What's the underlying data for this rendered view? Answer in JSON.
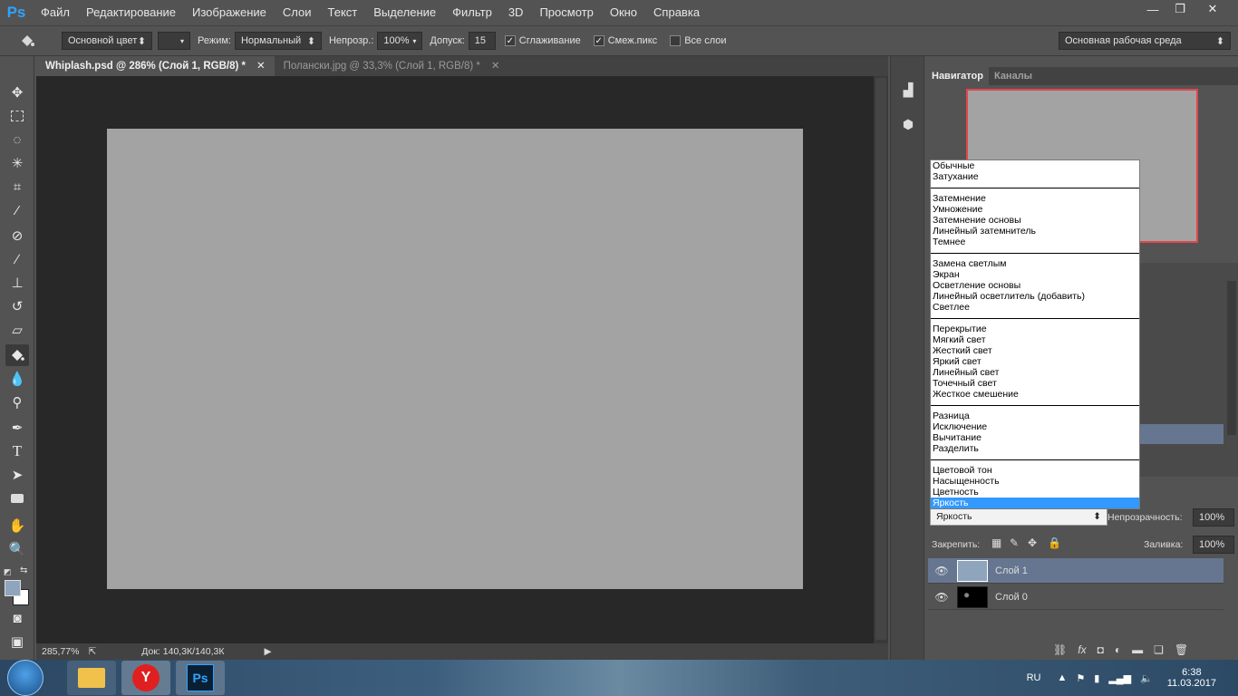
{
  "app": {
    "logo": "Ps",
    "menu": [
      "Файл",
      "Редактирование",
      "Изображение",
      "Слои",
      "Текст",
      "Выделение",
      "Фильтр",
      "3D",
      "Просмотр",
      "Окно",
      "Справка"
    ],
    "window_buttons": [
      "—",
      "❐",
      "✕"
    ]
  },
  "options": {
    "source": "Основной цвет",
    "mode_label": "Режим:",
    "mode_value": "Нормальный",
    "opacity_label": "Непрозр.:",
    "opacity_value": "100%",
    "tolerance_label": "Допуск:",
    "tolerance_value": "15",
    "antialias_label": "Сглаживание",
    "contiguous_label": "Смеж.пикс",
    "all_layers_label": "Все слои",
    "workspace": "Основная рабочая среда"
  },
  "tabs": [
    {
      "label": "Whiplash.psd @ 286% (Слой 1, RGB/8) *",
      "close": "✕"
    },
    {
      "label": "Полански.jpg @ 33,3% (Слой 1, RGB/8) *",
      "close": "✕"
    }
  ],
  "status": {
    "zoom": "285,77%",
    "doc": "Док: 140,3К/140,3К"
  },
  "navigator": {
    "tab_navigator": "Навигатор",
    "tab_channels": "Каналы"
  },
  "blend_modes": [
    [
      "Обычные",
      "Затухание"
    ],
    [
      "Затемнение",
      "Умножение",
      "Затемнение основы",
      "Линейный затемнитель",
      "Темнее"
    ],
    [
      "Замена светлым",
      "Экран",
      "Осветление основы",
      "Линейный осветлитель (добавить)",
      "Светлее"
    ],
    [
      "Перекрытие",
      "Мягкий свет",
      "Жесткий свет",
      "Яркий свет",
      "Линейный свет",
      "Точечный свет",
      "Жесткое смешение"
    ],
    [
      "Разница",
      "Исключение",
      "Вычитание",
      "Разделить"
    ],
    [
      "Цветовой тон",
      "Насыщенность",
      "Цветность",
      "Яркость"
    ]
  ],
  "blend_selected": "Яркость",
  "layers_panel": {
    "blend_value": "Яркость",
    "opacity_label": "Непрозрачность:",
    "opacity_value": "100%",
    "lock_label": "Закрепить:",
    "fill_label": "Заливка:",
    "fill_value": "100%",
    "layers": [
      {
        "name": "Слой 1",
        "selected": true
      },
      {
        "name": "Слой 0",
        "selected": false
      }
    ]
  },
  "taskbar": {
    "language": "RU",
    "time": "6:38",
    "date": "11.03.2017"
  },
  "colors": {
    "accent": "#3399ff",
    "canvas": "#a3a3a3",
    "nav_frame": "#e0474c",
    "layer_selected": "#667690",
    "foreground": "#8fa4bd",
    "background": "#ffffff"
  }
}
